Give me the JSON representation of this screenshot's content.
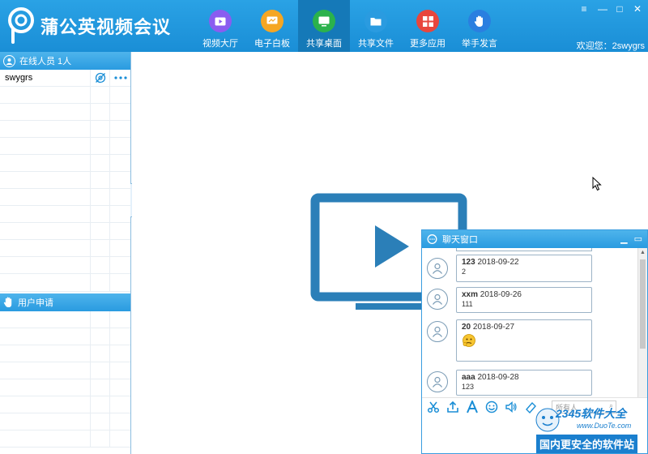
{
  "app": {
    "title": "蒲公英视频会议",
    "welcome": "欢迎您：2swygrs"
  },
  "window_controls": {
    "menu": "≡",
    "minimize": "—",
    "maximize": "□",
    "close": "✕"
  },
  "nav": [
    {
      "label": "视频大厅",
      "icon": "video-hall-icon",
      "color": "#8a5cf0",
      "glyph": "▶"
    },
    {
      "label": "电子白板",
      "icon": "whiteboard-icon",
      "color": "#f5a623",
      "glyph": "▭"
    },
    {
      "label": "共享桌面",
      "icon": "share-desktop-icon",
      "color": "#2bb24c",
      "glyph": "▣"
    },
    {
      "label": "共享文件",
      "icon": "share-file-icon",
      "color": "#2a9be0",
      "glyph": "▤"
    },
    {
      "label": "更多应用",
      "icon": "more-apps-icon",
      "color": "#e8463d",
      "glyph": "▦"
    },
    {
      "label": "举手发言",
      "icon": "raise-hand-icon",
      "color": "#2a7fe0",
      "glyph": "✋"
    }
  ],
  "online_panel": {
    "title": "在线人员 1人",
    "users": [
      {
        "name": "swygrs"
      }
    ]
  },
  "request_panel": {
    "title": "用户申请"
  },
  "chat": {
    "title": "聊天窗口",
    "recipient_placeholder": "所有人",
    "messages": [
      {
        "user": "123",
        "date": "2018-09-22",
        "text": "2"
      },
      {
        "user": "xxm",
        "date": "2018-09-26",
        "text": "111"
      },
      {
        "user": "20",
        "date": "2018-09-27",
        "text": ""
      },
      {
        "user": "aaa",
        "date": "2018-09-28",
        "text": "123"
      }
    ]
  },
  "watermark": {
    "top": "2345软件大全",
    "url": "www.DuoTe.com",
    "bottom": "国内更安全的软件站"
  },
  "colors": {
    "accent": "#1a8ed6",
    "screen_icon": "#2b7fb8"
  }
}
